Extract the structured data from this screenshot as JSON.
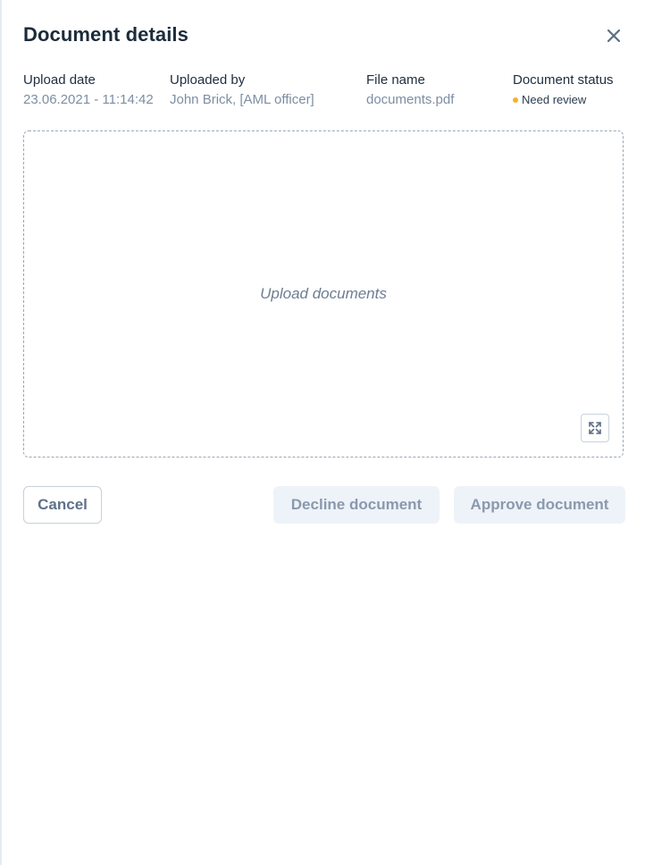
{
  "dialog": {
    "title": "Document details"
  },
  "meta": {
    "upload_date": {
      "label": "Upload date",
      "value": "23.06.2021 - 11:14:42"
    },
    "uploaded_by": {
      "label": "Uploaded by",
      "value": "John Brick, [AML officer]"
    },
    "file_name": {
      "label": "File name",
      "value": "documents.pdf"
    },
    "document_status": {
      "label": "Document status",
      "value": "Need review",
      "dot_color": "#f5b133"
    }
  },
  "dropzone": {
    "text": "Upload documents"
  },
  "actions": {
    "cancel_label": "Cancel",
    "decline_label": "Decline document",
    "approve_label": "Approve document"
  },
  "icons": {
    "close": "close-icon",
    "expand": "expand-icon"
  },
  "colors": {
    "primary_text": "#1c2b3a",
    "muted_text": "#7d8ea3",
    "disabled_button_bg": "#eef3f9",
    "status_warning": "#f5b133"
  }
}
